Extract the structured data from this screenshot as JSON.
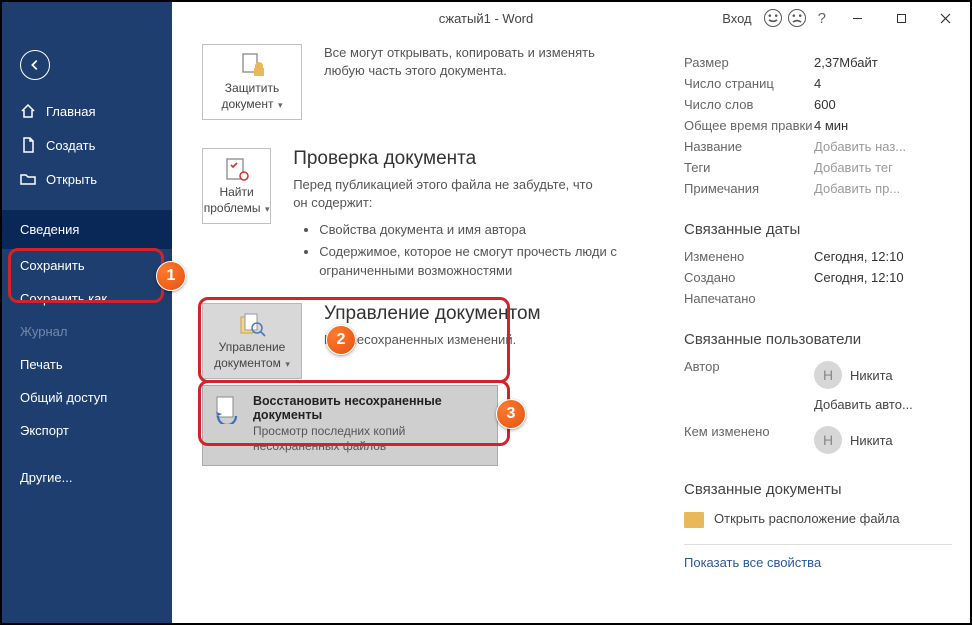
{
  "window": {
    "title": "сжатый1  -  Word",
    "login": "Вход"
  },
  "sidebar": {
    "items": [
      {
        "label": "Главная"
      },
      {
        "label": "Создать"
      },
      {
        "label": "Открыть"
      },
      {
        "label": "Сведения"
      },
      {
        "label": "Сохранить"
      },
      {
        "label": "Сохранить как"
      },
      {
        "label": "Журнал"
      },
      {
        "label": "Печать"
      },
      {
        "label": "Общий доступ"
      },
      {
        "label": "Экспорт"
      },
      {
        "label": "Другие..."
      }
    ]
  },
  "center": {
    "protect": {
      "btn_line1": "Защитить",
      "btn_line2": "документ",
      "desc": "Все могут открывать, копировать и изменять любую часть этого документа."
    },
    "inspect": {
      "btn_line1": "Найти",
      "btn_line2": "проблемы",
      "title": "Проверка документа",
      "desc": "Перед публикацией этого файла не забудьте, что он содержит:",
      "bullets": [
        "Свойства документа и имя автора",
        "Содержимое, которое не смогут прочесть люди с ограниченными возможностями"
      ]
    },
    "manage": {
      "btn_line1": "Управление",
      "btn_line2": "документом",
      "title": "Управление документом",
      "desc": "Нет несохраненных изменений.",
      "drop_title": "Восстановить несохраненные документы",
      "drop_sub": "Просмотр последних копий несохраненных файлов"
    }
  },
  "right": {
    "props": [
      {
        "k": "Размер",
        "v": "2,37Мбайт"
      },
      {
        "k": "Число страниц",
        "v": "4"
      },
      {
        "k": "Число слов",
        "v": "600"
      },
      {
        "k": "Общее время правки",
        "v": "4 мин"
      },
      {
        "k": "Название",
        "v": "Добавить наз...",
        "hint": true
      },
      {
        "k": "Теги",
        "v": "Добавить тег",
        "hint": true
      },
      {
        "k": "Примечания",
        "v": "Добавить пр...",
        "hint": true
      }
    ],
    "dates_title": "Связанные даты",
    "dates": [
      {
        "k": "Изменено",
        "v": "Сегодня, 12:10"
      },
      {
        "k": "Создано",
        "v": "Сегодня, 12:10"
      },
      {
        "k": "Напечатано",
        "v": ""
      }
    ],
    "users_title": "Связанные пользователи",
    "author_label": "Автор",
    "author_name": "Никита",
    "add_author": "Добавить авто...",
    "modified_by_label": "Кем изменено",
    "modified_by_name": "Никита",
    "docs_title": "Связанные документы",
    "open_location": "Открыть расположение файла",
    "show_all": "Показать все свойства"
  }
}
